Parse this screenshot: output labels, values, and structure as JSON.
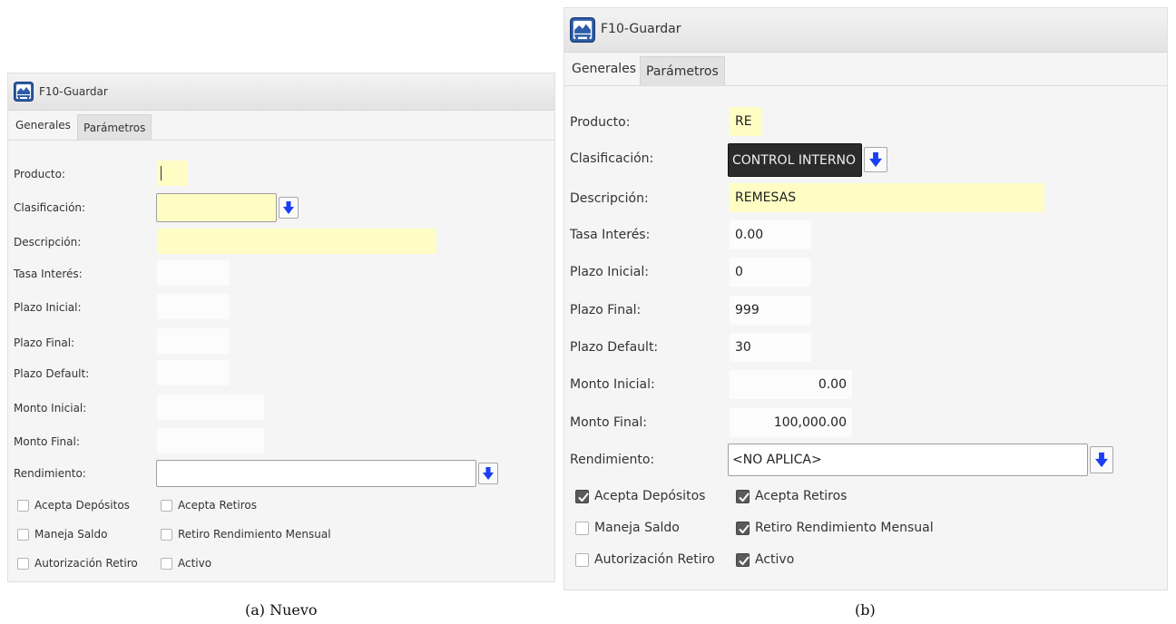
{
  "left": {
    "title": "F10-Guardar",
    "tabs": [
      "Generales",
      "Parámetros"
    ],
    "labels": {
      "producto": "Producto:",
      "clasificacion": "Clasificación:",
      "descripcion": "Descripción:",
      "tasa": "Tasa Interés:",
      "plazo_inicial": "Plazo Inicial:",
      "plazo_final": "Plazo Final:",
      "plazo_default": "Plazo Default:",
      "monto_inicial": "Monto Inicial:",
      "monto_final": "Monto Final:",
      "rendimiento": "Rendimiento:"
    },
    "values": {
      "producto": "",
      "clasificacion": "",
      "descripcion": "",
      "tasa": "",
      "plazo_inicial": "",
      "plazo_final": "",
      "plazo_default": "",
      "monto_inicial": "",
      "monto_final": "",
      "rendimiento": ""
    },
    "checkboxes": {
      "acepta_depositos": {
        "label": "Acepta Depósitos",
        "checked": false
      },
      "acepta_retiros": {
        "label": "Acepta Retiros",
        "checked": false
      },
      "maneja_saldo": {
        "label": "Maneja Saldo",
        "checked": false
      },
      "retiro_rendimiento": {
        "label": "Retiro Rendimiento Mensual",
        "checked": false
      },
      "autorizacion_retiro": {
        "label": "Autorización Retiro",
        "checked": false
      },
      "activo": {
        "label": "Activo",
        "checked": false
      }
    },
    "caption": "(a)  Nuevo"
  },
  "right": {
    "title": "F10-Guardar",
    "tabs": [
      "Generales",
      "Parámetros"
    ],
    "labels": {
      "producto": "Producto:",
      "clasificacion": "Clasificación:",
      "descripcion": "Descripción:",
      "tasa": "Tasa Interés:",
      "plazo_inicial": "Plazo Inicial:",
      "plazo_final": "Plazo Final:",
      "plazo_default": "Plazo Default:",
      "monto_inicial": "Monto Inicial:",
      "monto_final": "Monto Final:",
      "rendimiento": "Rendimiento:"
    },
    "values": {
      "producto": "RE",
      "clasificacion": "CONTROL INTERNO",
      "descripcion": "REMESAS",
      "tasa": "0.00",
      "plazo_inicial": "0",
      "plazo_final": "999",
      "plazo_default": "30",
      "monto_inicial": "0.00",
      "monto_final": "100,000.00",
      "rendimiento": "<NO APLICA>"
    },
    "checkboxes": {
      "acepta_depositos": {
        "label": "Acepta Depósitos",
        "checked": true
      },
      "acepta_retiros": {
        "label": "Acepta Retiros",
        "checked": true
      },
      "maneja_saldo": {
        "label": "Maneja Saldo",
        "checked": false
      },
      "retiro_rendimiento": {
        "label": "Retiro Rendimiento Mensual",
        "checked": true
      },
      "autorizacion_retiro": {
        "label": "Autorización Retiro",
        "checked": false
      },
      "activo": {
        "label": "Activo",
        "checked": true
      }
    },
    "caption": "(b)"
  },
  "icons": {
    "app": "app-form-icon",
    "dropdown": "arrow-down-icon",
    "checkbox": "checkmark-icon"
  },
  "colors": {
    "required_field": "#fffdc4",
    "dropdown_arrow": "#1a3ef5"
  }
}
